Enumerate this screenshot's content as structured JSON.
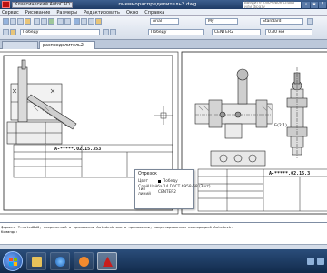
{
  "titlebar": {
    "workspace": "Классический AutoCAD",
    "title": "пневмораспределитель2.dwg",
    "search_placeholder": "Введите ключевое слово или фразу"
  },
  "menu": [
    "Сервис",
    "Рисование",
    "Размеры",
    "Редактировать",
    "Окно",
    "Справка"
  ],
  "toolbar": {
    "layer_name": "Победу",
    "text_style": "Arial",
    "dim_style": "My",
    "table_style": "Standard",
    "linetype": "Победу",
    "linetype2": "CENTER2",
    "lineweight": "0.30 мм"
  },
  "tabs": [
    "распределитель2"
  ],
  "tooltip": {
    "title": "Отрезок",
    "rows": [
      {
        "key": "Цвет",
        "value": "Победу",
        "swatch": true
      },
      {
        "key": "Слой",
        "value": "Шайба 14 ГОСТ 6958-68 (Зшт)"
      },
      {
        "key": "Тип линий",
        "value": "CENTER2"
      }
    ]
  },
  "drawing": {
    "left_stamp": "А-*****.02.15.353",
    "right_stamp": "А-*****.02.15.3",
    "annotation": "Б(2:1)"
  },
  "command_line": [
    "формата TrustedDWG, сохраненный в приложении Autodesk или в приложении, лицензированном корпорацией Autodesk.",
    "Команда:"
  ],
  "taskbar": {
    "apps": [
      "windows-explorer",
      "browser",
      "media-player",
      "autocad"
    ],
    "active_app": "autocad"
  },
  "colors": {
    "title_bar": "#1e3b66",
    "drawing_bg": "#ffffff",
    "taskbar": "#1a3a63"
  }
}
